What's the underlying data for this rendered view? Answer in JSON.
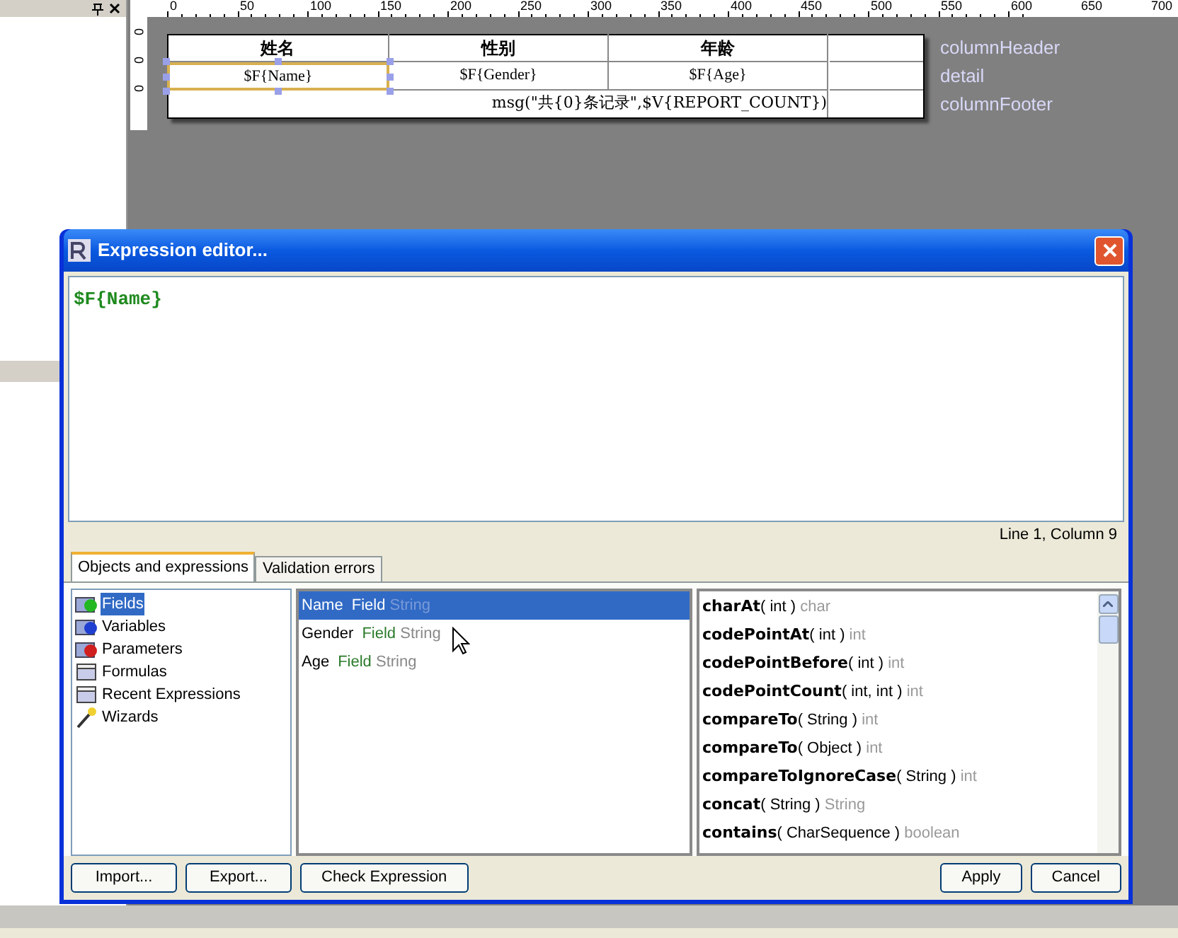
{
  "ruler": {
    "ticks": [
      "0",
      "50",
      "100",
      "150",
      "200",
      "250",
      "300",
      "350",
      "400",
      "450",
      "500",
      "550",
      "600",
      "650",
      "700"
    ]
  },
  "vertical_ruler": {
    "ticks": [
      "0",
      "0",
      "0"
    ]
  },
  "report": {
    "header_cells": [
      "姓名",
      "性别",
      "年龄"
    ],
    "detail_cells": [
      {
        "text": "$F{Name}",
        "selected": true
      },
      {
        "text": "$F{Gender}",
        "selected": false
      },
      {
        "text": "$F{Age}",
        "selected": false
      }
    ],
    "footer_text": "msg(\"共{0}条记录\",$V{REPORT_COUNT})",
    "band_labels": [
      "columnHeader",
      "detail",
      "columnFooter"
    ]
  },
  "dialog": {
    "title": "Expression editor...",
    "expression": "$F{Name}",
    "status": "Line 1, Column 9",
    "tabs": [
      {
        "label": "Objects and expressions",
        "selected": true
      },
      {
        "label": "Validation errors",
        "selected": false
      }
    ],
    "categories": [
      {
        "label": "Fields",
        "kind": "object_folder",
        "color": "#22b822",
        "selected": true
      },
      {
        "label": "Variables",
        "kind": "object_folder",
        "color": "#1f3fd0",
        "selected": false
      },
      {
        "label": "Parameters",
        "kind": "object_folder",
        "color": "#d01f1f",
        "selected": false
      },
      {
        "label": "Formulas",
        "kind": "folder",
        "selected": false
      },
      {
        "label": "Recent Expressions",
        "kind": "folder",
        "selected": false
      },
      {
        "label": "Wizards",
        "kind": "wizard",
        "selected": false
      }
    ],
    "objects": [
      {
        "name": "Name",
        "type": "Field",
        "class": "String",
        "selected": true
      },
      {
        "name": "Gender",
        "type": "Field",
        "class": "String",
        "selected": false
      },
      {
        "name": "Age",
        "type": "Field",
        "class": "String",
        "selected": false
      }
    ],
    "methods": [
      {
        "name": "charAt",
        "params": "( int )",
        "returns": "char"
      },
      {
        "name": "codePointAt",
        "params": "( int )",
        "returns": "int"
      },
      {
        "name": "codePointBefore",
        "params": "( int )",
        "returns": "int"
      },
      {
        "name": "codePointCount",
        "params": "( int, int )",
        "returns": "int"
      },
      {
        "name": "compareTo",
        "params": "( String )",
        "returns": "int"
      },
      {
        "name": "compareTo",
        "params": "( Object )",
        "returns": "int"
      },
      {
        "name": "compareToIgnoreCase",
        "params": "( String )",
        "returns": "int"
      },
      {
        "name": "concat",
        "params": "( String )",
        "returns": "String"
      },
      {
        "name": "contains",
        "params": "( CharSequence )",
        "returns": "boolean"
      }
    ],
    "buttons_left": [
      "Import...",
      "Export...",
      "Check Expression"
    ],
    "buttons_right": [
      "Apply",
      "Cancel"
    ]
  }
}
